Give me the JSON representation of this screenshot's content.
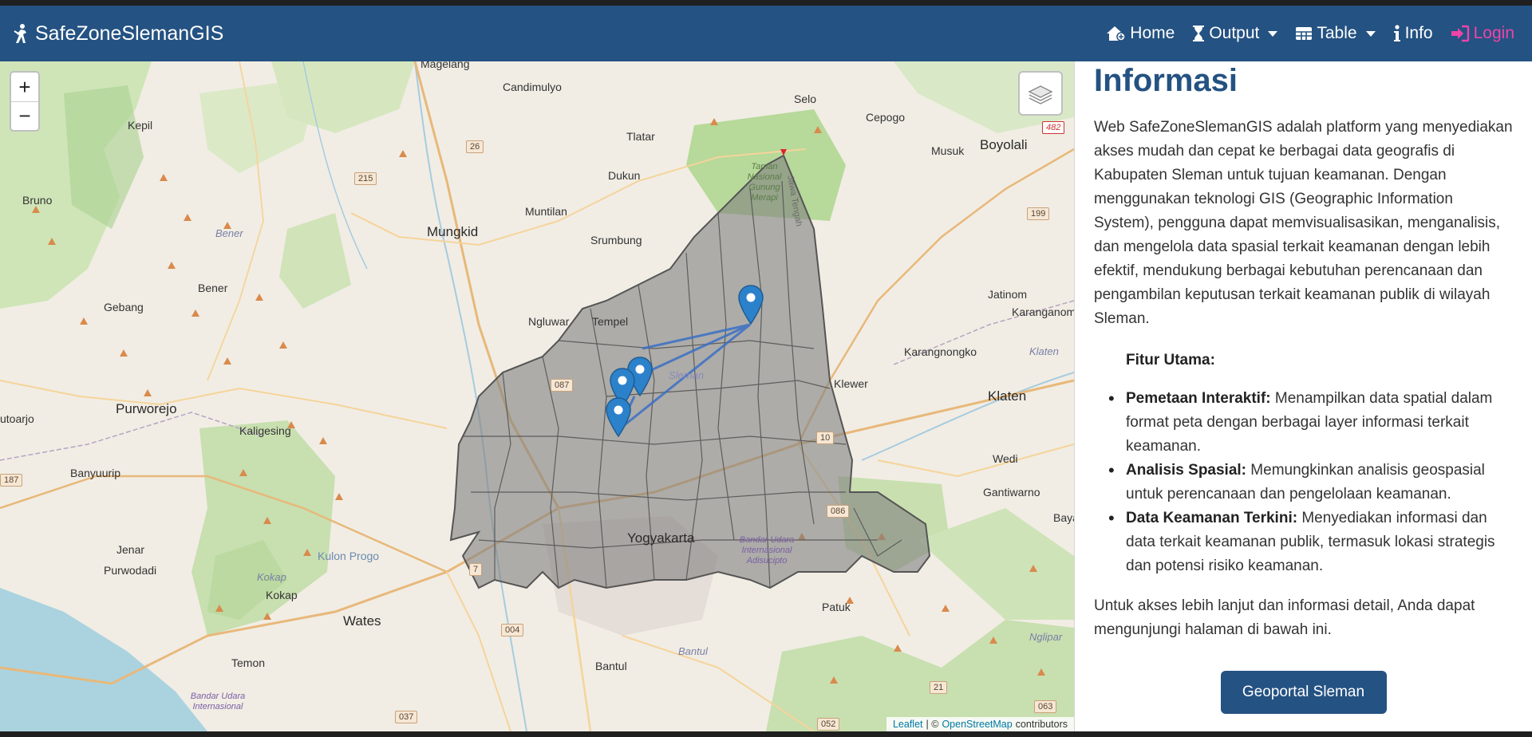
{
  "brand": {
    "title": "SafeZoneSlemanGIS",
    "icon": "person-icon"
  },
  "nav": {
    "home": "Home",
    "output": "Output",
    "table": "Table",
    "info": "Info",
    "login": "Login"
  },
  "map": {
    "labels": {
      "magelang": "Magelang",
      "candimulyo": "Candimulyo",
      "selo": "Selo",
      "cepogo": "Cepogo",
      "musuk": "Musuk",
      "boyolali": "Boyolali",
      "kepil": "Kepil",
      "tlatar": "Tlatar",
      "dukun": "Dukun",
      "bruno": "Bruno",
      "muntilan": "Muntilan",
      "srumbung": "Srumbung",
      "mungkid": "Mungkid",
      "bener": "Bener",
      "bener2": "Bener",
      "gebang": "Gebang",
      "ngluwar": "Ngluwar",
      "tempel": "Tempel",
      "jatinom": "Jatinom",
      "karanganom": "Karanganom",
      "karangnongko": "Karangnongko",
      "klaten": "Klaten",
      "klaten2": "Klaten",
      "klewer": "Klewer",
      "purworejo": "Purworejo",
      "kaligesing": "Kaligesing",
      "utoarjo": "utoarjo",
      "banyuurip": "Banyuurip",
      "wedi": "Wedi",
      "gantiwarno": "Gantiwarno",
      "bayat": "Baya",
      "jenar": "Jenar",
      "purwodadi": "Purwodadi",
      "kulonprogo": "Kulon Progo",
      "kokap": "Kokap",
      "kokap2": "Kokap",
      "yogyakarta": "Yogyakarta",
      "wates": "Wates",
      "patuk": "Patuk",
      "temon": "Temon",
      "bantul": "Bantul",
      "bantul2": "Bantul",
      "nglipar": "Nglipar",
      "sleman": "Sleman",
      "merapi": "Taman Nasional Gunung Merapi",
      "jawatengah": "Jawa Tengah",
      "bandara1": "Bandar Udara Internasional Adisucipto",
      "bandara2": "Bandar Udara Internasional"
    },
    "shields": {
      "r26": "26",
      "r215": "215",
      "r199": "199",
      "r187": "187",
      "r7": "7",
      "r004": "004",
      "r037": "037",
      "r052": "052",
      "r21": "21",
      "r063": "063",
      "r086": "086",
      "r10": "10",
      "r087": "087",
      "r482": "482"
    },
    "zoom_in": "+",
    "zoom_out": "−",
    "attribution": {
      "leaflet": "Leaflet",
      "sep": "| ©",
      "osm": "OpenStreetMap",
      "contributors": "contributors"
    }
  },
  "info": {
    "title": "Informasi",
    "intro": "Web SafeZoneSlemanGIS adalah platform yang menyediakan akses mudah dan cepat ke berbagai data geografis di Kabupaten Sleman untuk tujuan keamanan. Dengan menggunakan teknologi GIS (Geographic Information System), pengguna dapat memvisualisasikan, menganalisis, dan mengelola data spasial terkait keamanan dengan lebih efektif, mendukung berbagai kebutuhan perencanaan dan pengambilan keputusan terkait keamanan publik di wilayah Sleman.",
    "features_title": "Fitur Utama:",
    "features": [
      {
        "name": "Pemetaan Interaktif:",
        "desc": " Menampilkan data spatial dalam format peta dengan berbagai layer informasi terkait keamanan."
      },
      {
        "name": "Analisis Spasial:",
        "desc": " Memungkinkan analisis geospasial untuk perencanaan dan pengelolaan keamanan."
      },
      {
        "name": "Data Keamanan Terkini:",
        "desc": " Menyediakan informasi dan data terkait keamanan publik, termasuk lokasi strategis dan potensi risiko keamanan."
      }
    ],
    "outro": "Untuk akses lebih lanjut dan informasi detail, Anda dapat mengunjungi halaman di bawah ini.",
    "button": "Geoportal Sleman"
  }
}
